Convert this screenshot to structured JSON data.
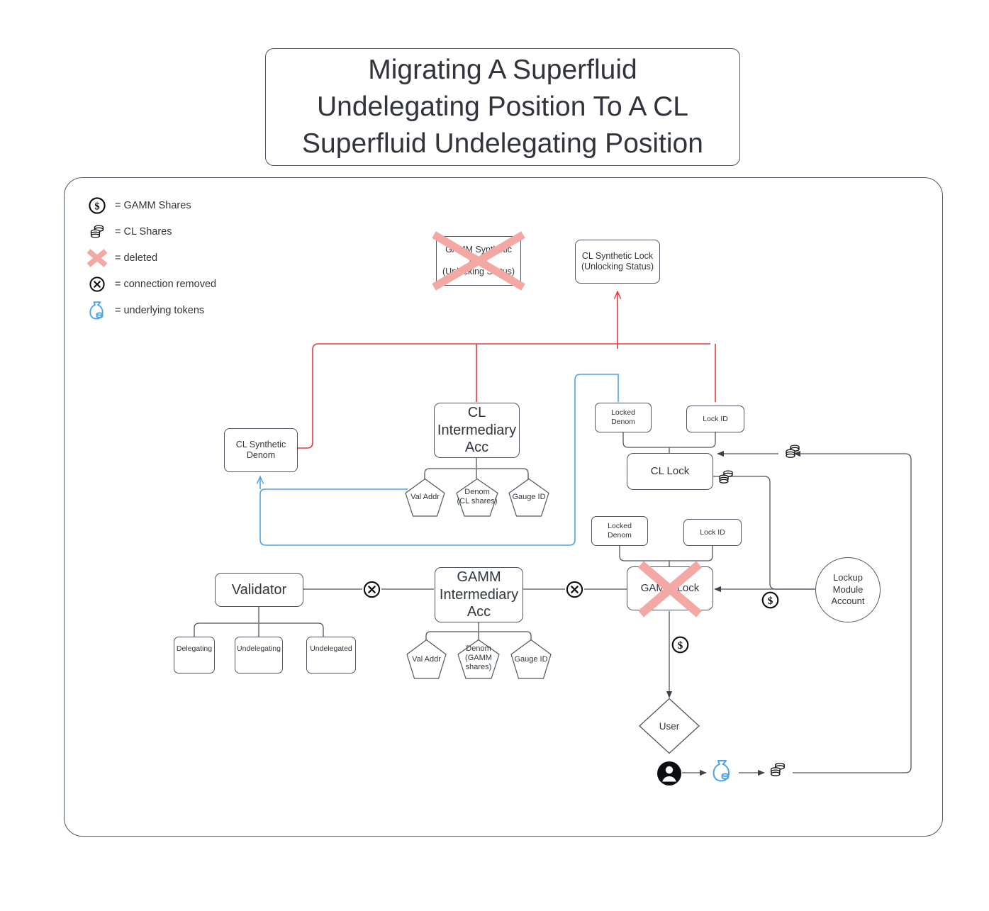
{
  "title": "Migrating A Superfluid\nUndelegating Position To A CL\nSuperfluid Undelegating Position",
  "colors": {
    "stroke": "#4d5560",
    "text": "#31353b",
    "red": "#e8383d",
    "blue": "#4da3e8",
    "deleted_x": "#f3a8a4",
    "arrow": "#3b4149"
  },
  "legend": {
    "items": [
      {
        "icon": "dollar-coin-icon",
        "label": "= GAMM Shares"
      },
      {
        "icon": "coin-stack-icon",
        "label": "= CL Shares"
      },
      {
        "icon": "red-x-icon",
        "label": "= deleted"
      },
      {
        "icon": "circle-x-icon",
        "label": "= connection removed"
      },
      {
        "icon": "money-bag-icon",
        "label": "= underlying tokens"
      }
    ]
  },
  "nodes": {
    "gamm_synthetic_lock": "GAMM Synthetic\nLock\n(Unlocking Status)",
    "cl_synthetic_lock": "CL Synthetic Lock\n(Unlocking Status)",
    "cl_synthetic_denom": "CL Synthetic\nDenom",
    "cl_intermediary_acc": "CL\nIntermediary\nAcc",
    "cl_val_addr": "Val Addr",
    "cl_denom": "Denom\n(CL shares)",
    "cl_gauge_id": "Gauge ID",
    "cl_locked_denom": "Locked\nDenom",
    "cl_lock_id": "Lock ID",
    "cl_lock": "CL Lock",
    "gamm_locked_denom": "Locked\nDenom",
    "gamm_lock_id": "Lock ID",
    "gamm_lock": "GAMM Lock",
    "lockup_module_account": "Lockup\nModule\nAccount",
    "validator": "Validator",
    "validator_delegating": "Delegating",
    "validator_undelegating": "Undelegating",
    "validator_undelegated": "Undelegated",
    "gamm_intermediary_acc": "GAMM\nIntermediary\nAcc",
    "gamm_val_addr": "Val Addr",
    "gamm_denom": "Denom\n(GAMM\nshares)",
    "gamm_gauge_id": "Gauge ID",
    "user": "User"
  }
}
